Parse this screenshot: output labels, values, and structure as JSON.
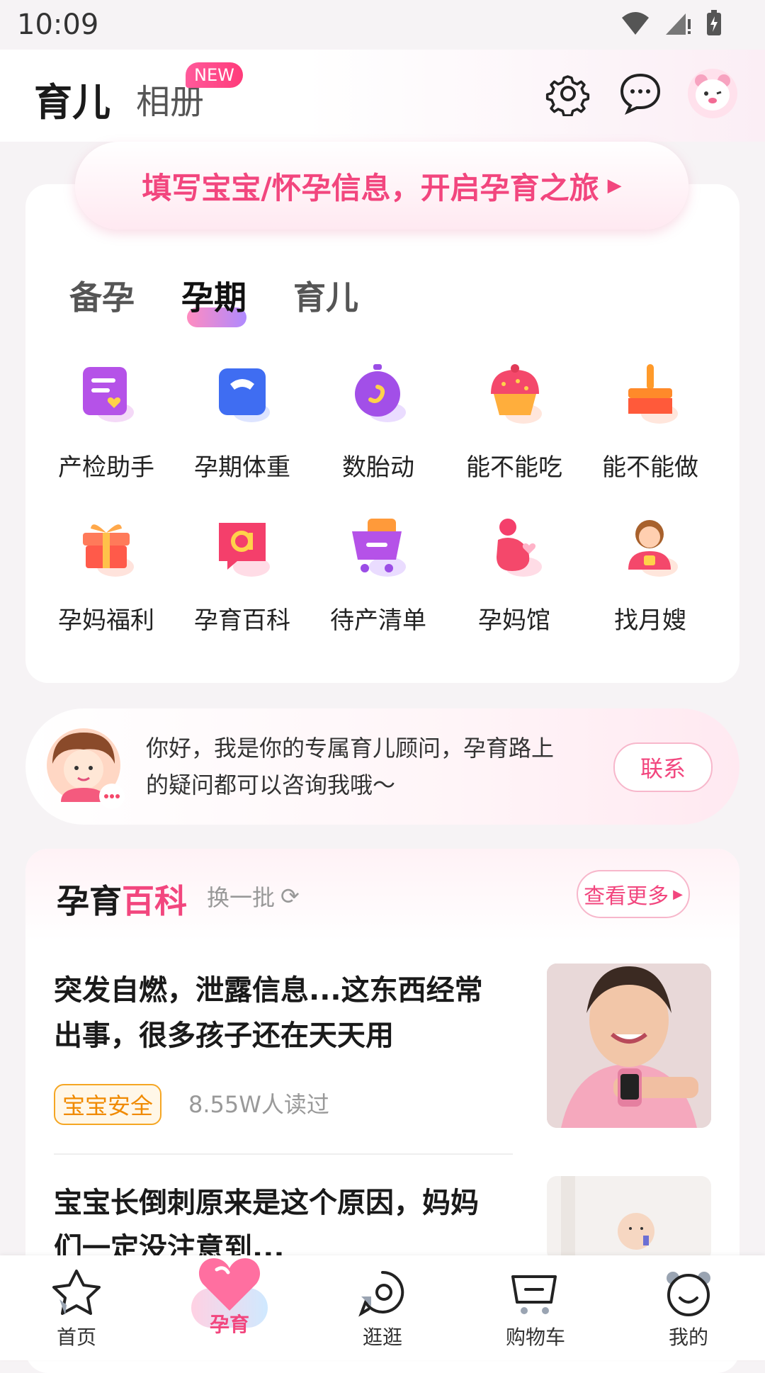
{
  "status_bar": {
    "time": "10:09"
  },
  "header": {
    "tab_active": "育儿",
    "tab_album": "相册",
    "album_badge": "NEW"
  },
  "banner": {
    "text": "填写宝宝/怀孕信息，开启孕育之旅"
  },
  "stage_tabs": [
    {
      "label": "备孕",
      "active": false
    },
    {
      "label": "孕期",
      "active": true
    },
    {
      "label": "育儿",
      "active": false
    }
  ],
  "tools": [
    {
      "label": "产检助手",
      "icon": "checkup-icon"
    },
    {
      "label": "孕期体重",
      "icon": "scale-icon"
    },
    {
      "label": "数胎动",
      "icon": "fetal-movement-icon"
    },
    {
      "label": "能不能吃",
      "icon": "cupcake-icon"
    },
    {
      "label": "能不能做",
      "icon": "brush-icon"
    },
    {
      "label": "孕妈福利",
      "icon": "gift-icon"
    },
    {
      "label": "孕育百科",
      "icon": "encyclopedia-icon"
    },
    {
      "label": "待产清单",
      "icon": "cart-list-icon"
    },
    {
      "label": "孕妈馆",
      "icon": "mom-pavilion-icon"
    },
    {
      "label": "找月嫂",
      "icon": "nanny-icon"
    }
  ],
  "advisor": {
    "line1": "你好，我是你的专属育儿顾问，孕育路上",
    "line2": "的疑问都可以咨询我哦～",
    "button": "联系"
  },
  "encyclopedia": {
    "title_black": "孕育",
    "title_pink": "百科",
    "refresh": "换一批",
    "more": "查看更多",
    "articles": [
      {
        "title_line1": "突发自燃，泄露信息...这东西经常",
        "title_line2": "出事，很多孩子还在天天用",
        "tag": "宝宝安全",
        "reads": "8.55W人读过"
      },
      {
        "title_line1": "宝宝长倒刺原来是这个原因，妈妈",
        "title_line2": "们一定没注意到..."
      }
    ]
  },
  "tabbar": [
    {
      "label": "首页",
      "icon": "home-star-icon",
      "active": false
    },
    {
      "label": "孕育",
      "icon": "heart-icon",
      "active": true
    },
    {
      "label": "逛逛",
      "icon": "explore-icon",
      "active": false
    },
    {
      "label": "购物车",
      "icon": "cart-icon",
      "active": false
    },
    {
      "label": "我的",
      "icon": "profile-icon",
      "active": false
    }
  ],
  "colors": {
    "accent": "#f2467e",
    "tag": "#f08a00"
  }
}
